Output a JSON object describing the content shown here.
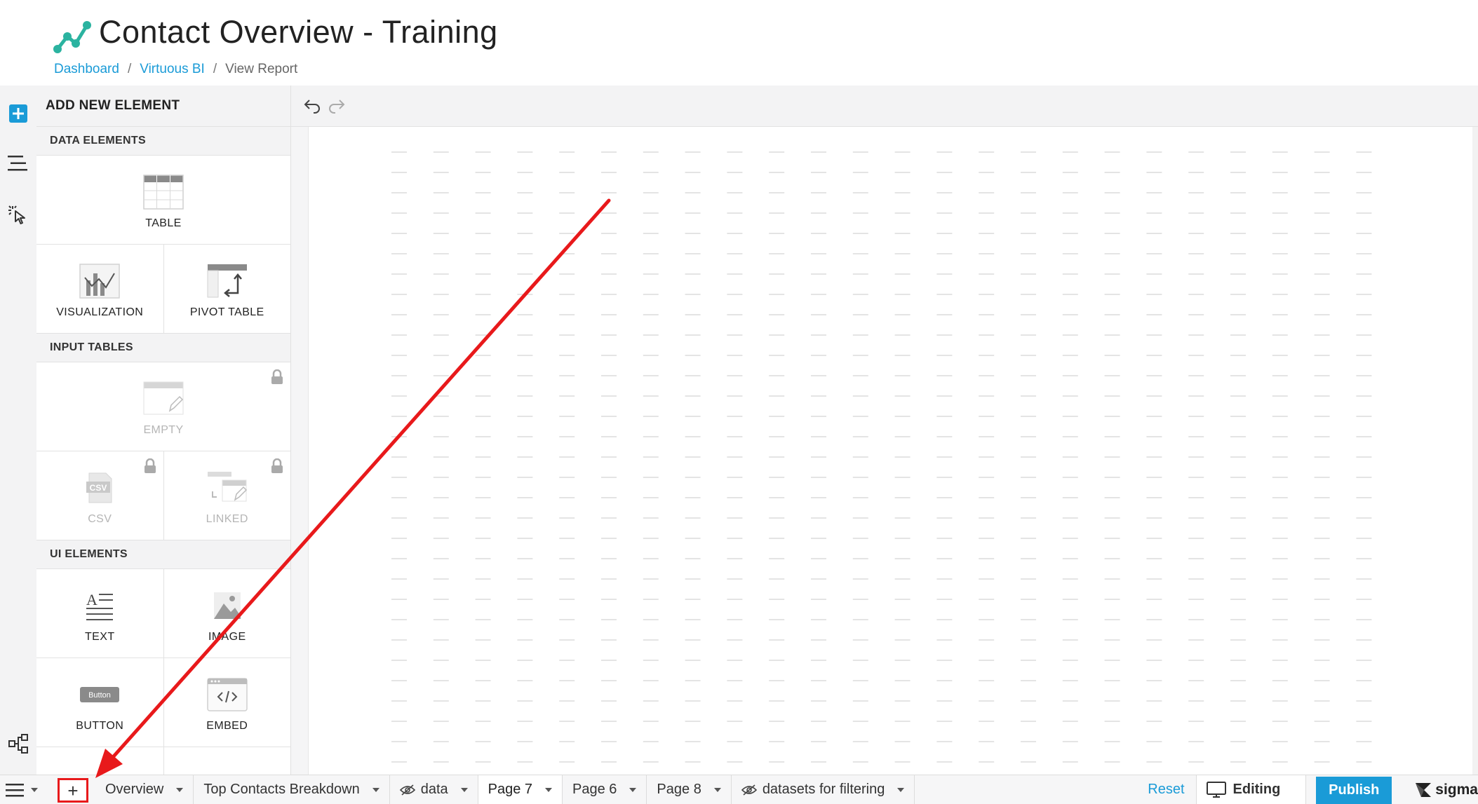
{
  "header": {
    "title": "Contact Overview - Training",
    "breadcrumb": [
      {
        "label": "Dashboard"
      },
      {
        "label": "Virtuous BI"
      },
      {
        "label": "View Report"
      }
    ]
  },
  "rail": {
    "icons": [
      "add-element-icon",
      "outline-icon",
      "select-pointer-icon",
      "lineage-icon"
    ]
  },
  "panel": {
    "title": "ADD NEW ELEMENT",
    "sections": {
      "data_elements": "DATA ELEMENTS",
      "input_tables": "INPUT TABLES",
      "ui_elements": "UI ELEMENTS"
    },
    "tiles": {
      "table": "TABLE",
      "visualization": "VISUALIZATION",
      "pivot_table": "PIVOT TABLE",
      "empty": "EMPTY",
      "csv": "CSV",
      "linked": "LINKED",
      "text": "TEXT",
      "image": "IMAGE",
      "button": "BUTTON",
      "embed": "EMBED"
    },
    "button_icon_text": "Button",
    "csv_icon_text": "CSV"
  },
  "toolbar": {
    "icons": [
      "undo-icon",
      "redo-icon"
    ]
  },
  "tabbar": {
    "add_symbol": "+",
    "tabs": [
      {
        "label": "Overview",
        "hidden": false,
        "active": false
      },
      {
        "label": "Top Contacts Breakdown",
        "hidden": false,
        "active": false
      },
      {
        "label": "data",
        "hidden": true,
        "active": false
      },
      {
        "label": "Page 7",
        "hidden": false,
        "active": true
      },
      {
        "label": "Page 6",
        "hidden": false,
        "active": false
      },
      {
        "label": "Page 8",
        "hidden": false,
        "active": false
      },
      {
        "label": "datasets for filtering",
        "hidden": true,
        "active": false
      }
    ],
    "reset_label": "Reset",
    "editing_label": "Editing",
    "publish_label": "Publish",
    "brand": "sigma"
  },
  "colors": {
    "accent": "#1a9bd7",
    "logo": "#2bb3a0",
    "annotation": "#e8191b"
  }
}
